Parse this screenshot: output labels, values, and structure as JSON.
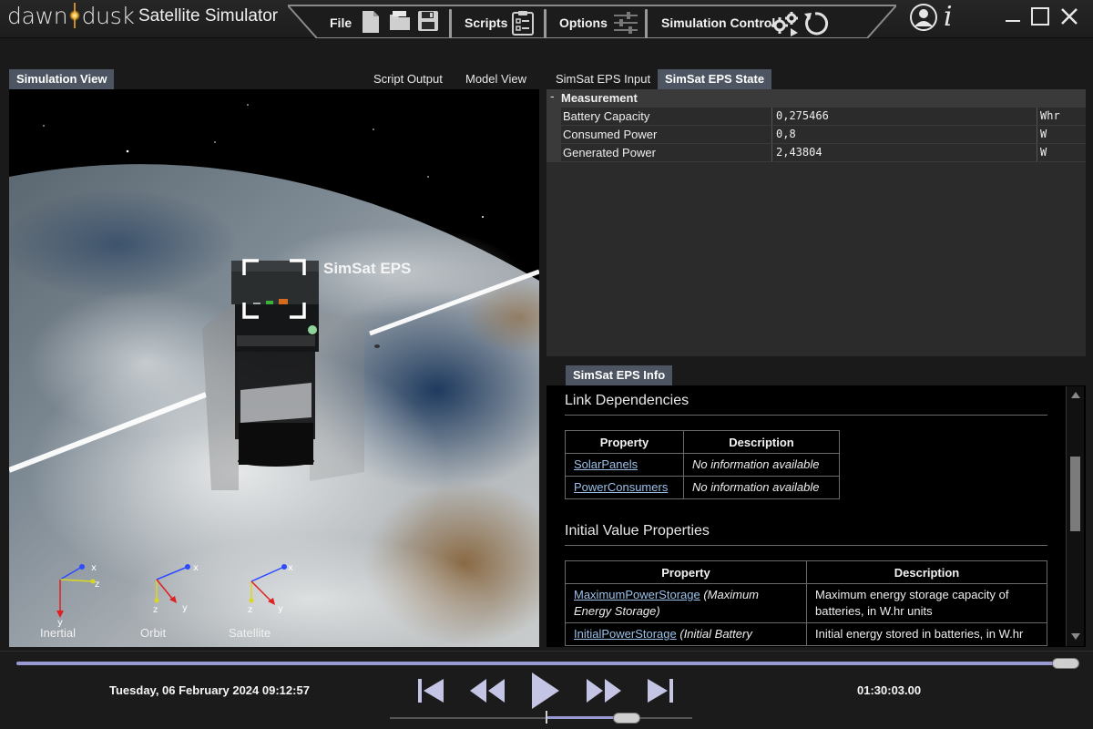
{
  "app": {
    "logo_text": "dawn dusk",
    "title": "Satellite Simulator"
  },
  "menu": {
    "file": "File",
    "scripts": "Scripts",
    "options": "Options",
    "simulation_control": "Simulation Control"
  },
  "tabs": [
    {
      "label": "Simulation View",
      "active": true
    },
    {
      "label": "Script Output",
      "active": false
    },
    {
      "label": "Model View",
      "active": false
    },
    {
      "label": "SimSat EPS Input",
      "active": false
    },
    {
      "label": "SimSat EPS State",
      "active": true
    }
  ],
  "simulation_view": {
    "object_label": "SimSat EPS",
    "frames": [
      {
        "name": "Inertial",
        "axes": [
          "x",
          "z",
          "y"
        ]
      },
      {
        "name": "Orbit",
        "axes": [
          "x",
          "z",
          "y"
        ]
      },
      {
        "name": "Satellite",
        "axes": [
          "x",
          "z",
          "y"
        ]
      }
    ]
  },
  "property_grid": {
    "group": "Measurement",
    "collapse_glyph": "-",
    "rows": [
      {
        "name": "Battery Capacity",
        "value": "0,275466",
        "unit": "Whr"
      },
      {
        "name": "Consumed Power",
        "value": "0,8",
        "unit": "W"
      },
      {
        "name": "Generated Power",
        "value": "2,43804",
        "unit": "W"
      }
    ]
  },
  "info": {
    "tab_label": "SimSat EPS Info",
    "link_dependencies": {
      "title": "Link Dependencies",
      "headers": [
        "Property",
        "Description"
      ],
      "rows": [
        {
          "property": "SolarPanels",
          "description": "No information available"
        },
        {
          "property": "PowerConsumers",
          "description": "No information available"
        }
      ]
    },
    "initial_values": {
      "title": "Initial Value Properties",
      "headers": [
        "Property",
        "Description"
      ],
      "rows": [
        {
          "property": "MaximumPowerStorage",
          "alias": "(Maximum Energy Storage)",
          "description": "Maximum energy storage capacity of batteries, in W.hr units"
        },
        {
          "property": "InitialPowerStorage",
          "alias": "(Initial Battery",
          "description": "Initial energy stored in batteries, in W.hr"
        }
      ]
    }
  },
  "playback": {
    "datetime": "Tuesday, 06 February 2024 09:12:57",
    "elapsed": "01:30:03.00"
  },
  "colors": {
    "accent_tab": "#4c5561",
    "timeline": "#9a9ad2",
    "link": "#9cc0e8"
  }
}
